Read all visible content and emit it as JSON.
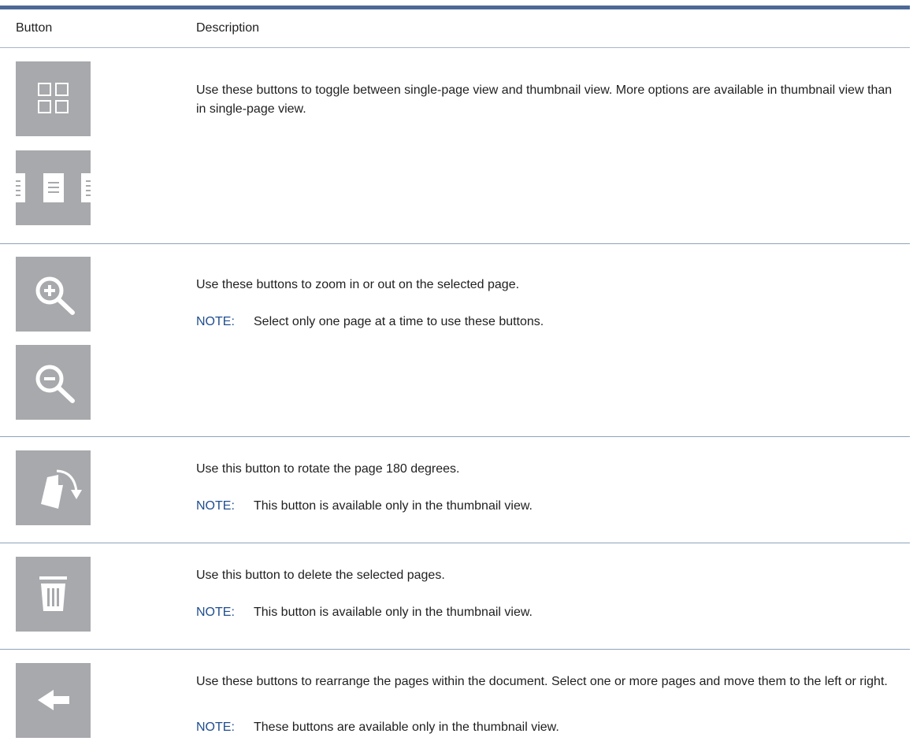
{
  "table": {
    "headers": {
      "button": "Button",
      "description": "Description"
    }
  },
  "rows": [
    {
      "description": "Use these buttons to toggle between single-page view and thumbnail view. More options are available in thumbnail view than in single-page view.",
      "buttons": [
        "thumbnail-view-icon",
        "single-page-view-icon"
      ]
    },
    {
      "description": "Use these buttons to zoom in or out on the selected page.",
      "note_label": "NOTE:",
      "note": "Select only one page at a time to use these buttons.",
      "buttons": [
        "zoom-in-icon",
        "zoom-out-icon"
      ]
    },
    {
      "description": "Use this button to rotate the page 180 degrees.",
      "note_label": "NOTE:",
      "note": "This button is available only in the thumbnail view.",
      "buttons": [
        "rotate-page-icon"
      ]
    },
    {
      "description": "Use this button to delete the selected pages.",
      "note_label": "NOTE:",
      "note": "This button is available only in the thumbnail view.",
      "buttons": [
        "delete-trash-icon"
      ]
    },
    {
      "description": "Use these buttons to rearrange the pages within the document. Select one or more pages and move them to the left or right.",
      "note_label": "NOTE:",
      "note": "These buttons are available only in the thumbnail view.",
      "buttons": [
        "move-left-arrow-icon"
      ]
    }
  ],
  "colors": {
    "button_gray": "#a7a9ac",
    "icon_white": "#ffffff",
    "note_blue": "#1f4e8f",
    "rule_blue": "#4d6a96"
  }
}
